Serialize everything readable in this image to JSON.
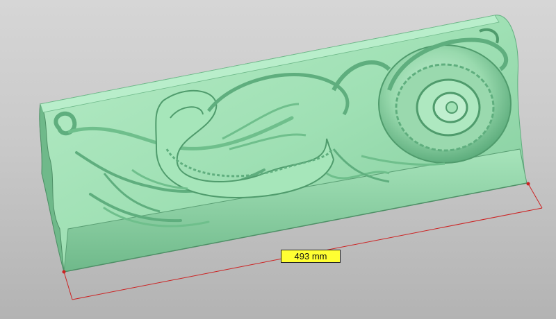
{
  "viewport": {
    "background_top": "#d6d6d6",
    "background_bottom": "#b3b3b3"
  },
  "model": {
    "surface_color": "#9fe0b4",
    "shade_color": "#5fae7e",
    "highlight_color": "#c8f2d6"
  },
  "measurement": {
    "label": "493 mm",
    "line_color": "#cc2222",
    "label_background": "#ffff33"
  }
}
